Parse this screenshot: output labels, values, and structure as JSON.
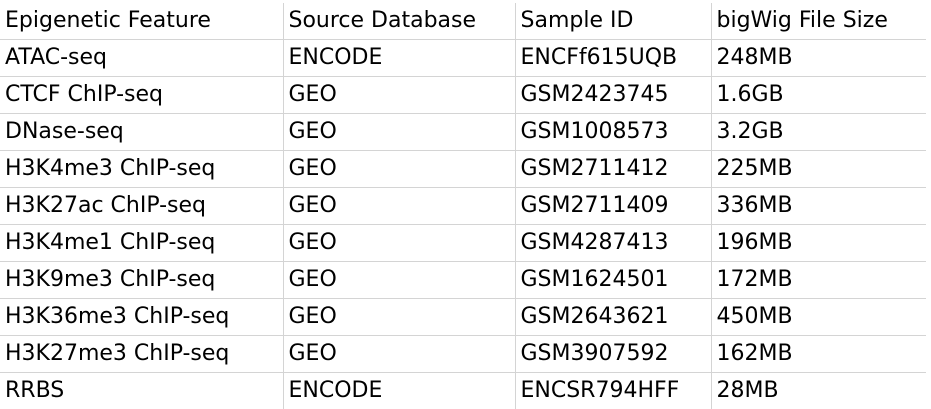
{
  "table": {
    "headers": [
      "Epigenetic Feature",
      "Source Database",
      "Sample ID",
      "bigWig File Size"
    ],
    "rows": [
      [
        "ATAC-seq",
        "ENCODE",
        "ENCFf615UQB",
        "248MB"
      ],
      [
        "CTCF ChIP-seq",
        "GEO",
        "GSM2423745",
        "1.6GB"
      ],
      [
        "DNase-seq",
        "GEO",
        "GSM1008573",
        "3.2GB"
      ],
      [
        "H3K4me3 ChIP-seq",
        "GEO",
        "GSM2711412",
        "225MB"
      ],
      [
        "H3K27ac ChIP-seq",
        "GEO",
        "GSM2711409",
        "336MB"
      ],
      [
        "H3K4me1 ChIP-seq",
        "GEO",
        "GSM4287413",
        "196MB"
      ],
      [
        "H3K9me3 ChIP-seq",
        "GEO",
        "GSM1624501",
        "172MB"
      ],
      [
        "H3K36me3 ChIP-seq",
        "GEO",
        "GSM2643621",
        "450MB"
      ],
      [
        "H3K27me3 ChIP-seq",
        "GEO",
        "GSM3907592",
        "162MB"
      ],
      [
        "RRBS",
        "ENCODE",
        "ENCSR794HFF",
        "28MB"
      ]
    ]
  },
  "colors": {
    "gridline": "#d4d4d4",
    "text": "#000000",
    "background": "#ffffff"
  }
}
